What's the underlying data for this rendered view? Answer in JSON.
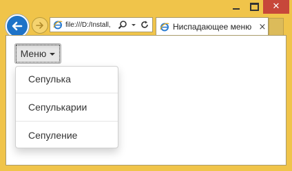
{
  "window": {
    "controls": {
      "minimize_icon": "minimize-icon",
      "maximize_icon": "maximize-icon",
      "close_label": "✕"
    }
  },
  "nav": {
    "back_icon": "back-arrow-icon",
    "forward_icon": "forward-arrow-icon"
  },
  "address_bar": {
    "url": "file:///D:/Install,",
    "search_icon": "search-icon",
    "dropdown_icon": "chevron-down-icon",
    "refresh_icon": "refresh-icon"
  },
  "tab": {
    "title": "Ниспадающее меню",
    "close_label": "×"
  },
  "page": {
    "menu_button_label": "Меню",
    "dropdown_items": [
      "Сепулька",
      "Сепулькарии",
      "Сепуление"
    ]
  },
  "colors": {
    "frame": "#f0c44a",
    "back_button": "#1e73c8",
    "close_button": "#c7473a"
  }
}
